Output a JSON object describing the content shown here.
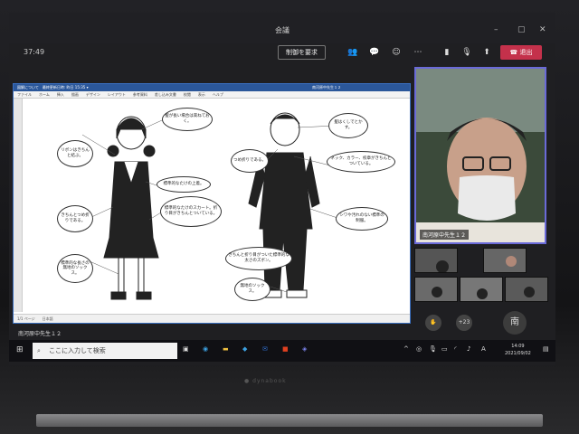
{
  "window": {
    "title": "会議",
    "controls": [
      "–",
      "▢",
      "✕"
    ]
  },
  "toolbar": {
    "elapsed": "37:49",
    "request_control": "制御を要求",
    "leave": "退出"
  },
  "document": {
    "title_bar": "図解について　最終更新日時: 昨日 15:35 ▾",
    "ribbon": [
      "ファイル",
      "ホーム",
      "挿入",
      "描画",
      "デザイン",
      "レイアウト",
      "参考資料",
      "差し込み文書",
      "校閲",
      "表示",
      "ヘルプ"
    ],
    "user": "南河原中先生１２",
    "status": "1/1 ページ　　日本語",
    "bubbles": {
      "b1": "髪が長い場合は束ねておく。",
      "b2": "リボンはきちんと結ぶ。",
      "b3": "標準的なたけの上着。",
      "b4": "標準的なたけのスカート。折り目がきちんとついている。",
      "b5": "きちんとつめ折りである。",
      "b6": "標準的な長さの無地のソックス。",
      "b7": "髪はくしでとかす。",
      "b8": "ネック、カラー、校章がきちんとついている。",
      "b9": "つめ折りである。",
      "b10": "シワや汚れのない標準の制服。",
      "b11": "きちんと折り目がついた標準的な太さのズボン。",
      "b12": "無地のソックス。"
    }
  },
  "presenter": {
    "name": "南河原中先生１２",
    "plus_count": "+23",
    "initial": "南",
    "label": "南河原中先生１２"
  },
  "taskbar": {
    "search_placeholder": "ここに入力して検索",
    "time": "14:09",
    "date": "2021/09/02",
    "ime": "A"
  },
  "laptop": {
    "brand": "● dynabook"
  }
}
